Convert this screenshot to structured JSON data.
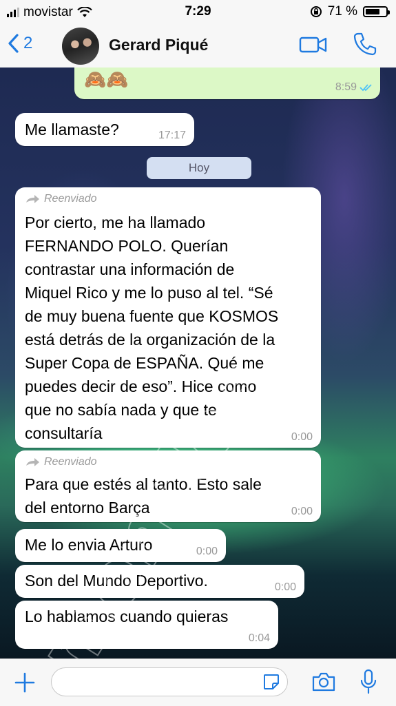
{
  "status_bar": {
    "carrier": "movistar",
    "time": "7:29",
    "battery": "71 %",
    "battery_level": 0.71
  },
  "header": {
    "back_count": "2",
    "contact_name": "Gerard Piqué"
  },
  "messages": {
    "emoji_msg": {
      "text": "🙈🙈",
      "time": "8:59"
    },
    "m1": {
      "text": "Me llamaste?",
      "time": "17:17"
    },
    "date_divider": "Hoy",
    "m2": {
      "forwarded": "Reenviado",
      "lines": [
        "Por cierto, me ha llamado",
        "FERNANDO POLO. Querían",
        "contrastar una información de",
        "Miquel Rico y me lo puso al tel. “Sé",
        "de muy buena fuente que KOSMOS",
        "está detrás de la organización de la",
        "Super Copa de ESPAÑA. Qué me",
        "puedes decir de eso”. Hice como",
        "que no sabía nada y que te",
        "consultaría"
      ],
      "time": "0:00"
    },
    "m3": {
      "forwarded": "Reenviado",
      "lines": [
        "Para que estés al tanto. Esto sale",
        "del entorno Barça"
      ],
      "time": "0:00"
    },
    "m4": {
      "text": "Me lo envia Arturo",
      "time": "0:00"
    },
    "m5": {
      "text": "Son del Mundo Deportivo.",
      "time": "0:00"
    },
    "m6": {
      "text": "Lo hablamos cuando quieras",
      "time": "0:04"
    }
  },
  "watermark": "moncloa",
  "colors": {
    "accent": "#1f7ae0",
    "outgoing_bubble": "#dcf8c6",
    "incoming_bubble": "#ffffff",
    "read_ticks": "#4fc3f7"
  },
  "icons": [
    "back-chevron-icon",
    "video-call-icon",
    "phone-icon",
    "forward-arrow-icon",
    "read-ticks-icon",
    "plus-icon",
    "sticker-icon",
    "camera-icon",
    "microphone-icon"
  ]
}
